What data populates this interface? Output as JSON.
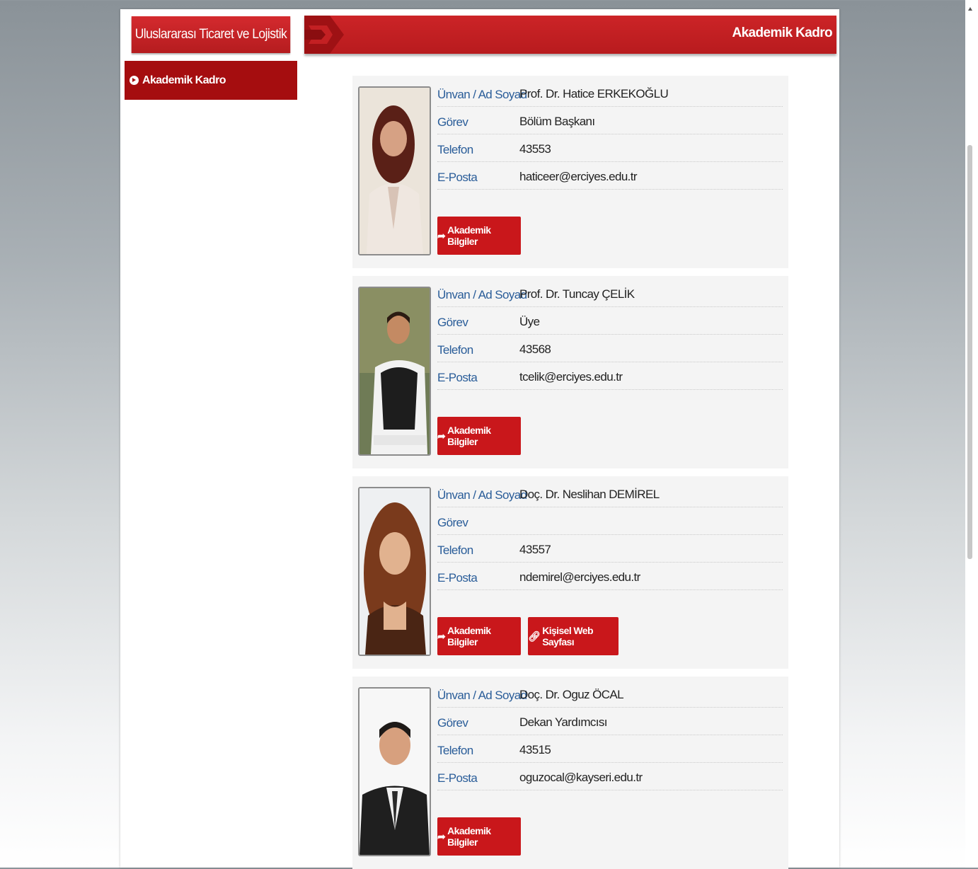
{
  "sidebar": {
    "title": "Uluslararası Ticaret ve Lojistik",
    "items": [
      {
        "label": "Akademik Kadro"
      }
    ]
  },
  "header": {
    "title": "Akademik Kadro"
  },
  "labels": {
    "name": "Ünvan / Ad Soyad",
    "role": "Görev",
    "phone": "Telefon",
    "email": "E-Posta"
  },
  "buttons": {
    "academic": "Akademik Bilgiler",
    "website": "Kişisel Web Sayfası"
  },
  "icons": {
    "academic": "share-arrow-icon",
    "website": "link-icon",
    "sidebar": "circle-arrow-icon"
  },
  "colors": {
    "primary": "#c9171b",
    "sidebar_active": "#a50d0f",
    "label": "#2a5d99"
  },
  "staff": [
    {
      "name": "Prof. Dr. Hatice ERKEKOĞLU",
      "role": "Bölüm Başkanı",
      "phone": "43553",
      "email": "haticeer@erciyes.edu.tr",
      "has_website": false
    },
    {
      "name": "Prof. Dr. Tuncay ÇELİK",
      "role": "Üye",
      "phone": "43568",
      "email": "tcelik@erciyes.edu.tr",
      "has_website": false
    },
    {
      "name": "Doç. Dr. Neslihan DEMİREL",
      "role": "",
      "phone": "43557",
      "email": "ndemirel@erciyes.edu.tr",
      "has_website": true
    },
    {
      "name": "Doç. Dr. Oguz ÖCAL",
      "role": "Dekan Yardımcısı",
      "phone": "43515",
      "email": "oguzocal@kayseri.edu.tr",
      "has_website": false
    }
  ]
}
